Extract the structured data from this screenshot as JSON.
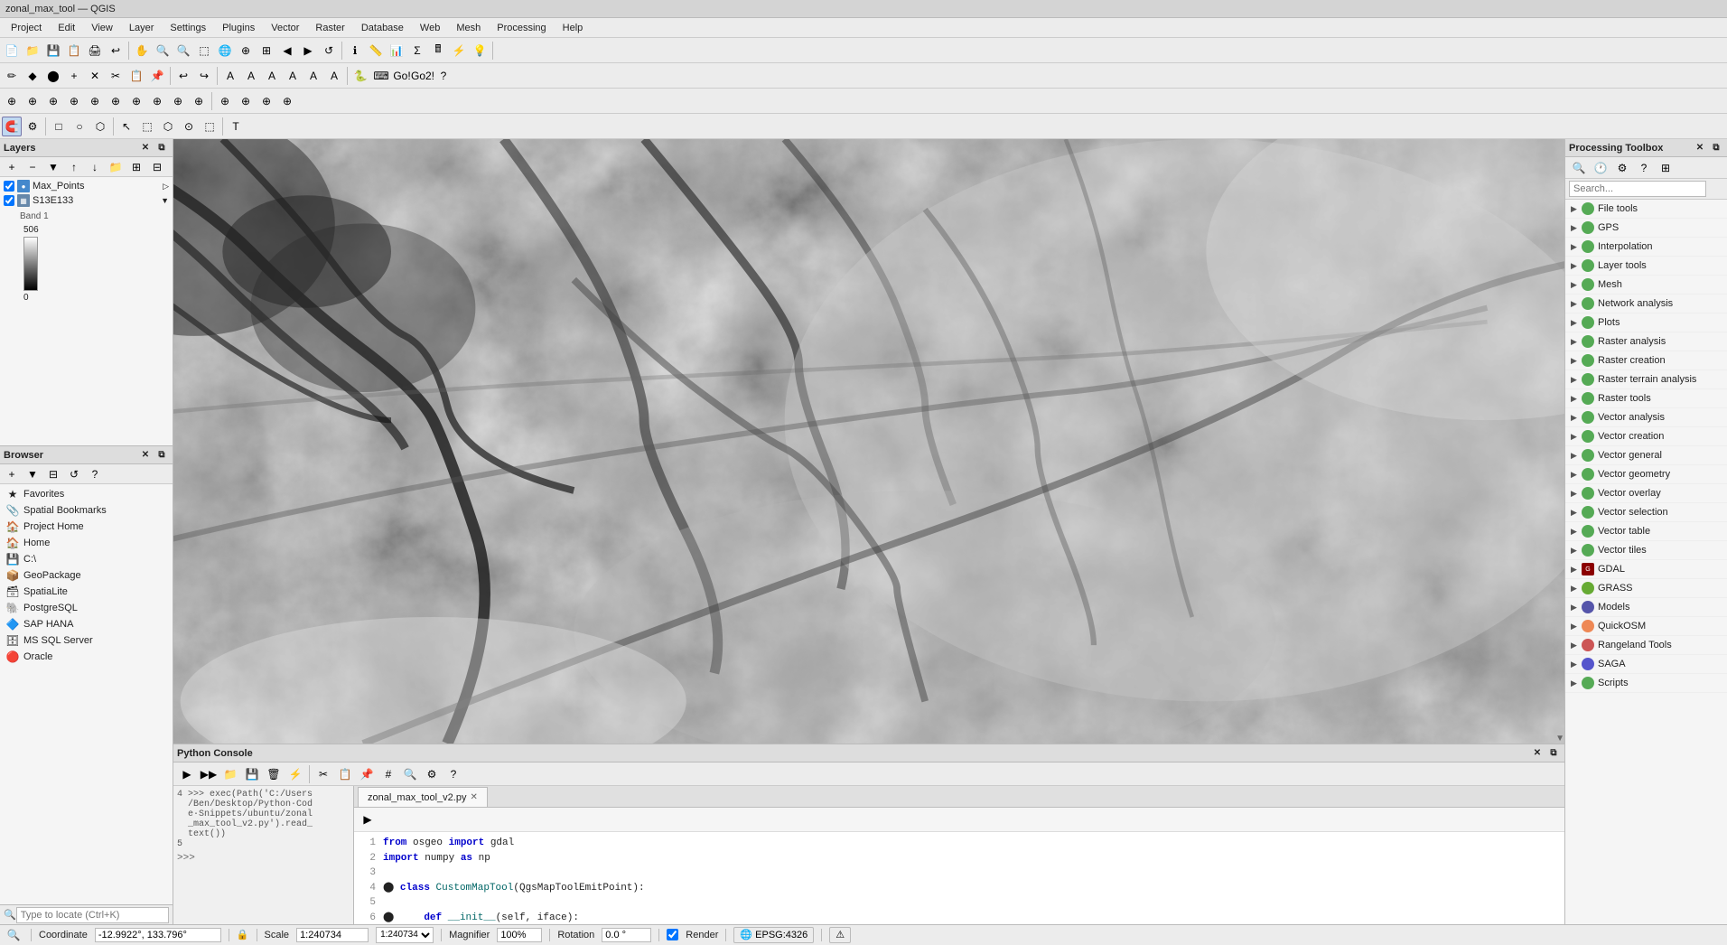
{
  "titlebar": {
    "text": "zonal_max_tool — QGIS"
  },
  "menubar": {
    "items": [
      "Project",
      "Edit",
      "View",
      "Layer",
      "Settings",
      "Plugins",
      "Vector",
      "Raster",
      "Database",
      "Web",
      "Mesh",
      "Processing",
      "Help"
    ]
  },
  "layers_panel": {
    "title": "Layers",
    "items": [
      {
        "name": "Max_Points",
        "type": "vector",
        "visible": true
      },
      {
        "name": "S13E133",
        "type": "raster",
        "visible": true
      }
    ],
    "band_label": "Band 1",
    "max_val": "506",
    "min_val": "0"
  },
  "browser_panel": {
    "title": "Browser",
    "items": [
      {
        "name": "Favorites",
        "icon": "★"
      },
      {
        "name": "Spatial Bookmarks",
        "icon": "📎"
      },
      {
        "name": "Project Home",
        "icon": "🏠"
      },
      {
        "name": "Home",
        "icon": "🏠"
      },
      {
        "name": "C:\\",
        "icon": "💾"
      },
      {
        "name": "GeoPackage",
        "icon": "📦"
      },
      {
        "name": "SpatiaLite",
        "icon": "🗃"
      },
      {
        "name": "PostgreSQL",
        "icon": "🐘"
      },
      {
        "name": "SAP HANA",
        "icon": "🔷"
      },
      {
        "name": "MS SQL Server",
        "icon": "🗄"
      },
      {
        "name": "Oracle",
        "icon": "🔴"
      }
    ]
  },
  "search_bar": {
    "placeholder": "Type to locate (Ctrl+K)"
  },
  "python_console": {
    "title": "Python Console",
    "tab_name": "zonal_max_tool_v2.py",
    "input_history": [
      "4 >>> exec(Path('C:/Users",
      "  /Ben/Desktop/Python·Cod",
      "  e·Snippets/ubuntu/zonal",
      "  _max_tool_v2.py').read_",
      "  text())",
      "5"
    ],
    "code_lines": [
      {
        "num": "1",
        "text": "from osgeo import gdal"
      },
      {
        "num": "2",
        "text": "import numpy as np"
      },
      {
        "num": "3",
        "text": ""
      },
      {
        "num": "4",
        "text": "class CustomMapTool(QgsMapToolEmitPoint):"
      },
      {
        "num": "5",
        "text": ""
      },
      {
        "num": "6",
        "text": "    def __init__(self, iface):"
      }
    ],
    "prompt": ">>>"
  },
  "processing_toolbox": {
    "title": "Processing Toolbox",
    "search_placeholder": "Search...",
    "items": [
      {
        "name": "File tools",
        "icon": "green"
      },
      {
        "name": "GPS",
        "icon": "green"
      },
      {
        "name": "Interpolation",
        "icon": "green"
      },
      {
        "name": "Layer tools",
        "icon": "green"
      },
      {
        "name": "Mesh",
        "icon": "green"
      },
      {
        "name": "Network analysis",
        "icon": "green"
      },
      {
        "name": "Plots",
        "icon": "green"
      },
      {
        "name": "Raster analysis",
        "icon": "green"
      },
      {
        "name": "Raster creation",
        "icon": "green"
      },
      {
        "name": "Raster terrain analysis",
        "icon": "green"
      },
      {
        "name": "Raster tools",
        "icon": "green"
      },
      {
        "name": "Vector analysis",
        "icon": "green"
      },
      {
        "name": "Vector creation",
        "icon": "green"
      },
      {
        "name": "Vector general",
        "icon": "green"
      },
      {
        "name": "Vector geometry",
        "icon": "green"
      },
      {
        "name": "Vector overlay",
        "icon": "green"
      },
      {
        "name": "Vector selection",
        "icon": "green"
      },
      {
        "name": "Vector table",
        "icon": "green"
      },
      {
        "name": "Vector tiles",
        "icon": "green"
      },
      {
        "name": "GDAL",
        "icon": "special"
      },
      {
        "name": "GRASS",
        "icon": "grass"
      },
      {
        "name": "Models",
        "icon": "model"
      },
      {
        "name": "QuickOSM",
        "icon": "osm"
      },
      {
        "name": "Rangeland Tools",
        "icon": "range"
      },
      {
        "name": "SAGA",
        "icon": "saga"
      },
      {
        "name": "Scripts",
        "icon": "green"
      }
    ]
  },
  "statusbar": {
    "coordinate_label": "Coordinate",
    "coordinate_value": "-12.9922°, 133.796°",
    "scale_label": "Scale",
    "scale_value": "1:240734",
    "magnifier_label": "Magnifier",
    "magnifier_value": "100%",
    "rotation_label": "Rotation",
    "rotation_value": "0.0 °",
    "render_label": "Render",
    "epsg_value": "EPSG:4326"
  },
  "icons": {
    "search": "🔍",
    "gear": "⚙",
    "close": "✕",
    "arrow_right": "▶",
    "arrow_down": "▼",
    "play": "▶",
    "stop": "■",
    "lock": "🔒",
    "eye": "👁",
    "plus": "+",
    "minus": "−",
    "refresh": "↺",
    "save": "💾",
    "folder": "📁"
  }
}
